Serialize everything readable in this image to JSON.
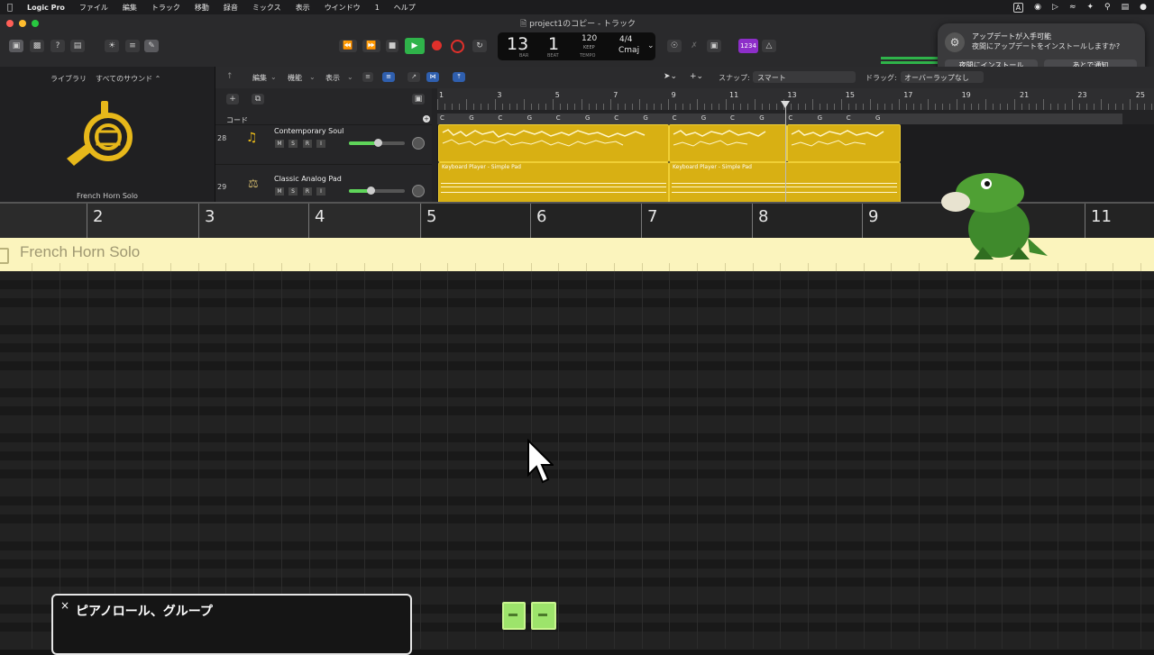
{
  "menubar": {
    "apple": "",
    "items": [
      "Logic Pro",
      "ファイル",
      "編集",
      "トラック",
      "移動",
      "録音",
      "ミックス",
      "表示",
      "ウインドウ",
      "1",
      "ヘルプ"
    ],
    "status_a": "A"
  },
  "window": {
    "title": "project1のコピー - トラック"
  },
  "lcd": {
    "bar": "13",
    "beat": "1",
    "bar_label": "BAR",
    "beat_label": "BEAT",
    "tempo": "120",
    "keep": "KEEP",
    "tempo_label": "TEMPO",
    "signature": "4/4",
    "key": "Cmaj"
  },
  "count_in": "1234",
  "notification": {
    "title": "アップデートが入手可能",
    "body": "夜間にアップデートをインストールしますか?",
    "install_label": "夜間にインストール",
    "later_label": "あとで通知"
  },
  "library": {
    "label": "ライブラリ",
    "filter": "すべてのサウンド ⌃",
    "patch_name": "French Horn Solo"
  },
  "tracks_toolbar": {
    "edit": "編集",
    "function": "機能",
    "view": "表示",
    "snap_label": "スナップ:",
    "snap_value": "スマート",
    "drag_label": "ドラッグ:",
    "drag_value": "オーバーラップなし"
  },
  "chord_track_label": "コード",
  "ruler_top": [
    "1",
    "3",
    "5",
    "7",
    "9",
    "11",
    "13",
    "15",
    "17",
    "19",
    "21",
    "23",
    "25"
  ],
  "chord_letters": [
    "C",
    "G",
    "C",
    "G",
    "C",
    "G",
    "C",
    "G",
    "C",
    "G",
    "C",
    "G",
    "C",
    "G",
    "C",
    "G"
  ],
  "tracks": [
    {
      "number": "28",
      "name": "Contemporary Soul",
      "m": "M",
      "s": "S",
      "r": "R",
      "i": "I"
    },
    {
      "number": "29",
      "name": "Classic Analog Pad",
      "m": "M",
      "s": "S",
      "r": "R",
      "i": "I"
    }
  ],
  "pad_region_label": "Keyboard Player - Simple Pad",
  "piano_roll": {
    "ruler": [
      "2",
      "3",
      "4",
      "5",
      "6",
      "7",
      "8",
      "9",
      "11"
    ],
    "region_name": "French Horn Solo"
  },
  "caption_panel": {
    "title": "ピアノロール、グループ",
    "close": "×"
  },
  "colors": {
    "region_yellow": "#d8b013",
    "horn_bar": "#fbf4bd",
    "play_green": "#2fb34a",
    "record_red": "#e0302b",
    "accent_purple": "#8d2ec9",
    "note_green": "#9de46b"
  }
}
